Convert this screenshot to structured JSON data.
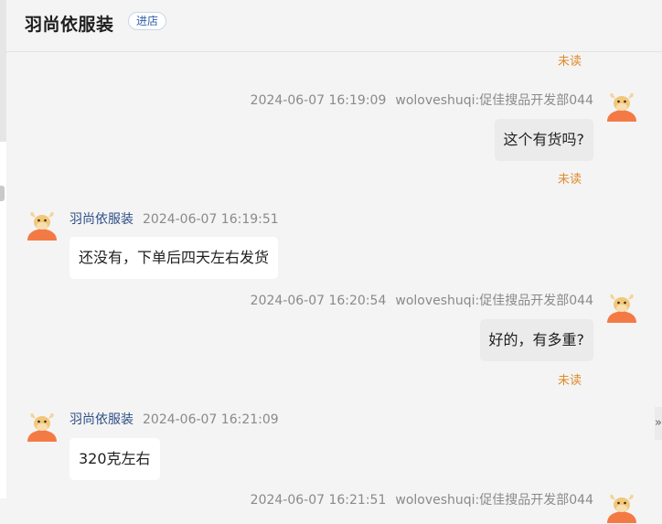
{
  "header": {
    "shop_name": "羽尚依服装",
    "enter_label": "进店"
  },
  "status": {
    "unread": "未读"
  },
  "messages": [
    {
      "time": "2024-06-07 16:19:09",
      "sender": "woloveshuqi:促佳搜品开发部044",
      "text": "这个有货吗?"
    },
    {
      "time": "2024-06-07 16:19:51",
      "sender": "羽尚依服装",
      "text": "还没有，下单后四天左右发货"
    },
    {
      "time": "2024-06-07 16:20:54",
      "sender": "woloveshuqi:促佳搜品开发部044",
      "text": "好的，有多重?"
    },
    {
      "time": "2024-06-07 16:21:09",
      "sender": "羽尚依服装",
      "text": "320克左右"
    },
    {
      "time": "2024-06-07 16:21:51",
      "sender": "woloveshuqi:促佳搜品开发部044"
    }
  ],
  "side_icon": "double-chevron-right-icon",
  "colors": {
    "unread": "#e08a2b",
    "sender": "#2f4f86",
    "avatar": "#f47a45",
    "self_bubble": "#ebebeb",
    "other_bubble": "#ffffff"
  }
}
